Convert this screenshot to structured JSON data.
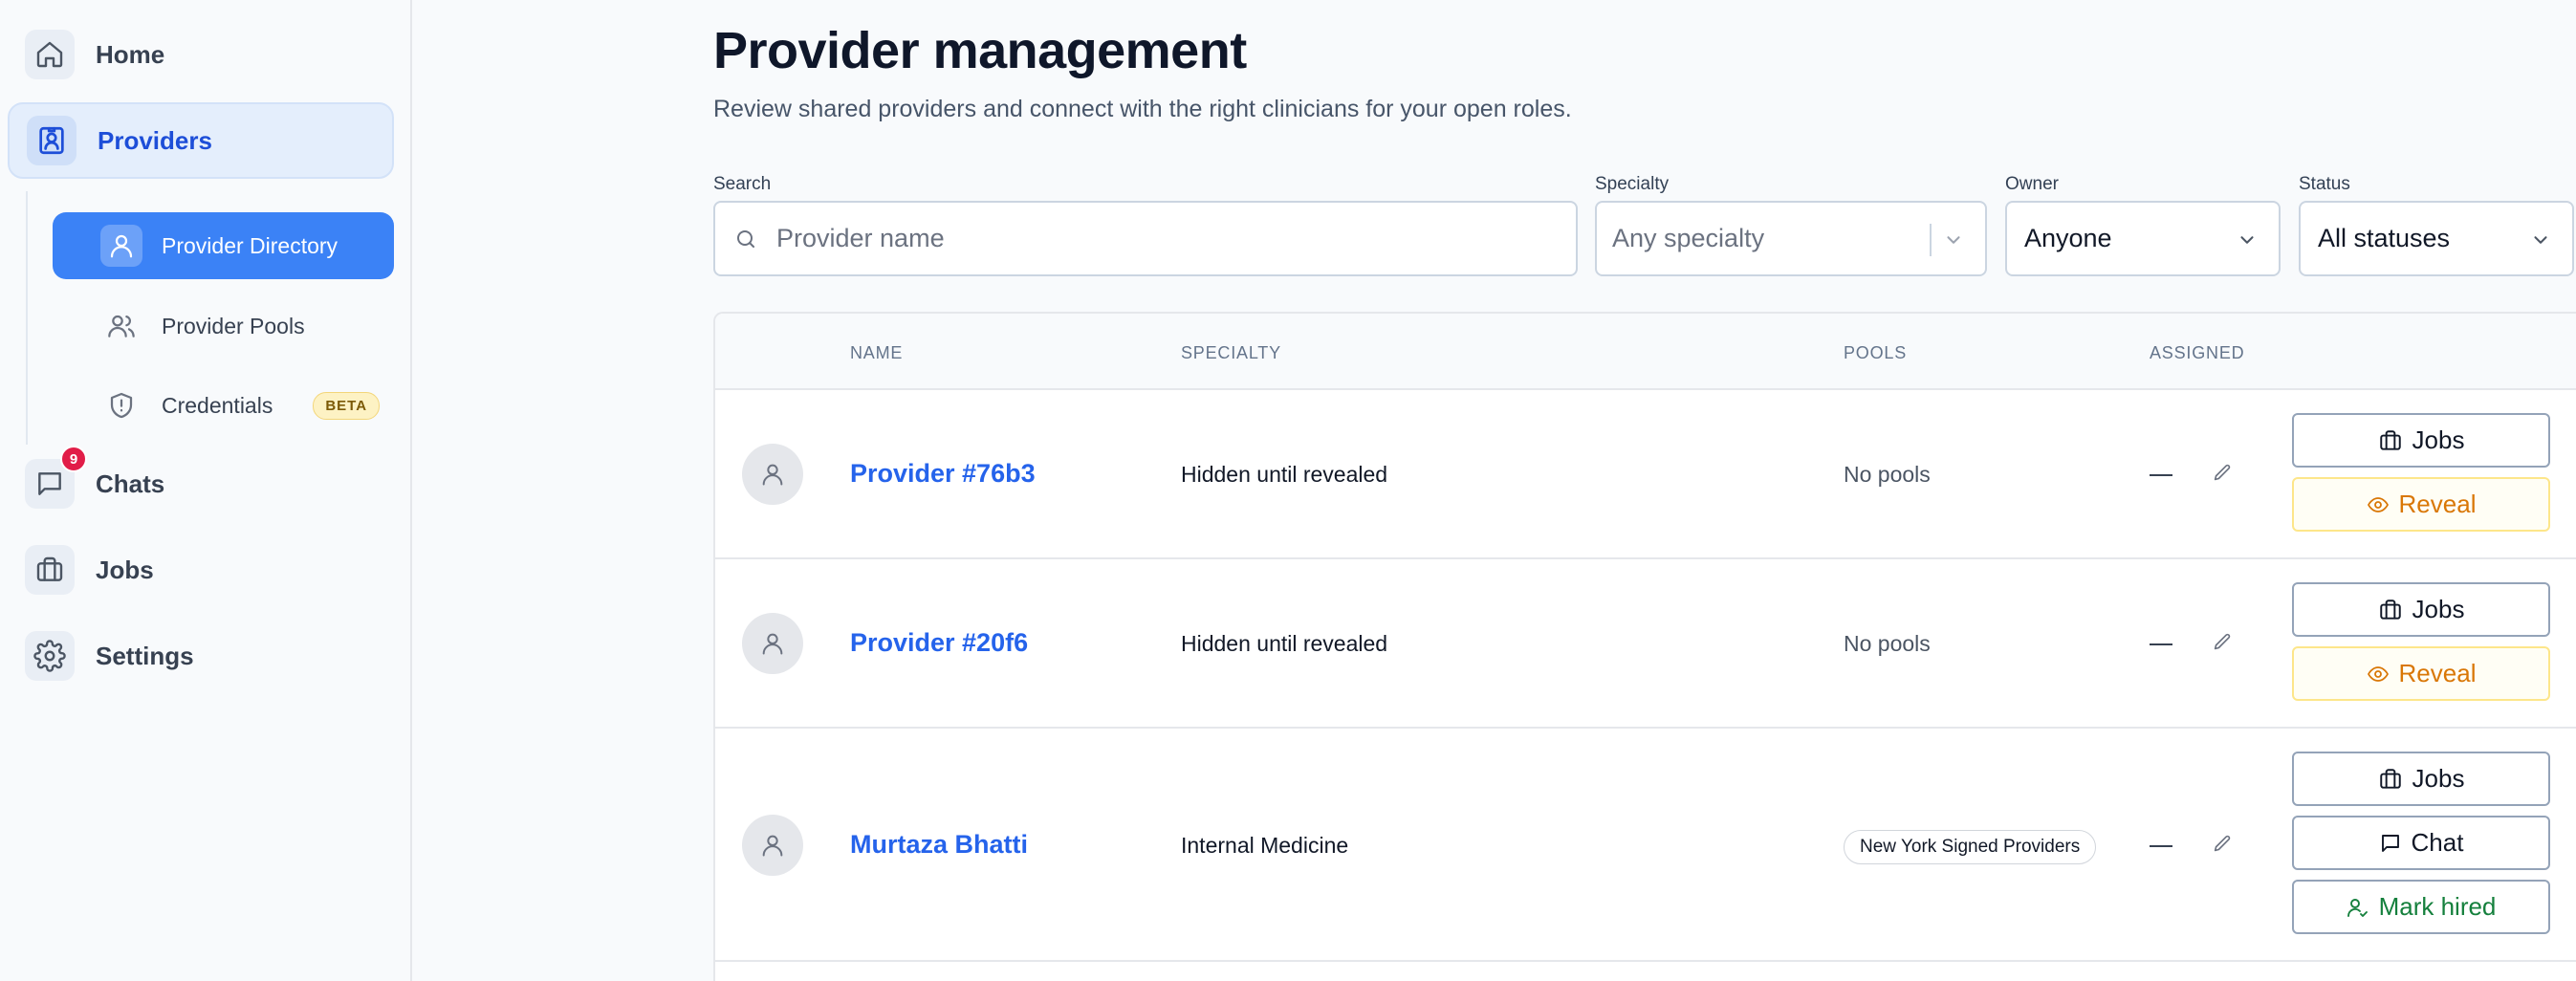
{
  "sidebar": {
    "items": [
      {
        "label": "Home",
        "icon": "home-icon"
      },
      {
        "label": "Providers",
        "icon": "provider-badge-icon"
      },
      {
        "label": "Chats",
        "icon": "chat-bubble-icon"
      },
      {
        "label": "Jobs",
        "icon": "briefcase-icon"
      },
      {
        "label": "Settings",
        "icon": "gear-icon"
      }
    ],
    "sub_items": [
      {
        "label": "Provider Directory",
        "icon": "user-icon"
      },
      {
        "label": "Provider Pools",
        "icon": "users-icon"
      },
      {
        "label": "Credentials",
        "icon": "shield-alert-icon",
        "badge": "BETA"
      }
    ],
    "chats_badge": "9",
    "accent": "#3b82f6"
  },
  "header": {
    "title": "Provider management",
    "subtitle": "Review shared providers and connect with the right clinicians for your open roles."
  },
  "filters": {
    "search": {
      "label": "Search",
      "placeholder": "Provider name"
    },
    "specialty": {
      "label": "Specialty",
      "placeholder": "Any specialty"
    },
    "owner": {
      "label": "Owner",
      "value": "Anyone"
    },
    "status": {
      "label": "Status",
      "value": "All statuses"
    }
  },
  "table": {
    "columns": [
      "NAME",
      "SPECIALTY",
      "POOLS",
      "ASSIGNED"
    ],
    "rows": [
      {
        "name": "Provider #76b3",
        "specialty": "Hidden until revealed",
        "pools": "No pools",
        "assigned": "—",
        "actions": {
          "jobs": "Jobs",
          "reveal": "Reveal"
        }
      },
      {
        "name": "Provider #20f6",
        "specialty": "Hidden until revealed",
        "pools": "No pools",
        "assigned": "—",
        "actions": {
          "jobs": "Jobs",
          "reveal": "Reveal"
        }
      },
      {
        "name": "Murtaza Bhatti",
        "specialty": "Internal Medicine",
        "pools": "New York Signed Providers",
        "assigned": "—",
        "actions": {
          "jobs": "Jobs",
          "chat": "Chat",
          "hire": "Mark hired"
        }
      }
    ]
  },
  "colors": {
    "link": "#2563eb",
    "reveal": "#d97706",
    "hire": "#15803d",
    "badge": "#e11d48"
  }
}
